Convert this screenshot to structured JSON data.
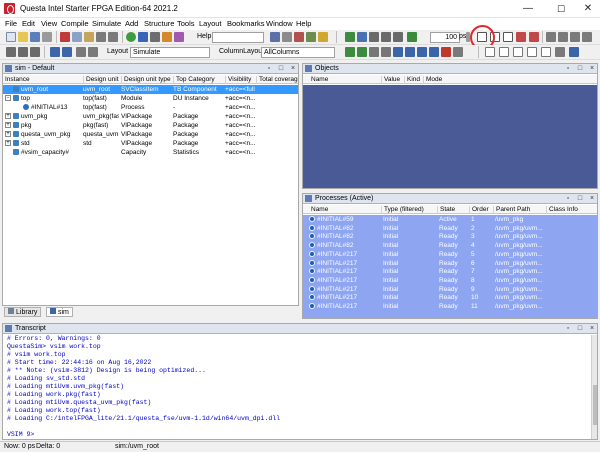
{
  "window": {
    "title": "Questa Intel Starter FPGA Edition-64 2021.2",
    "controls": {
      "minimize": "—",
      "maximize": "☐",
      "close": "✕"
    }
  },
  "menu": [
    "File",
    "Edit",
    "View",
    "Compile",
    "Simulate",
    "Add",
    "Structure",
    "Tools",
    "Layout",
    "Bookmarks",
    "Window",
    "Help"
  ],
  "toolbar": {
    "help_label": "Help",
    "help_value": "",
    "runtime_value": "100",
    "runtime_unit": "ps",
    "layout_label": "Layout",
    "layout_value": "Simulate",
    "column_layout_label": "ColumnLayout",
    "column_layout_value": "AllColumns"
  },
  "sim_pane": {
    "title": "sim - Default",
    "columns": [
      "Instance",
      "Design unit",
      "Design unit type",
      "Top Category",
      "Visibility",
      "Total coverage"
    ],
    "rows": [
      {
        "expander": "",
        "instance": "uvm_root",
        "design_unit": "uvm_root",
        "type": "SVClassItem",
        "category": "TB Component",
        "visibility": "+acc=<full>",
        "selected": true,
        "indent": 0
      },
      {
        "expander": "-",
        "instance": "top",
        "design_unit": "top(fast)",
        "type": "Module",
        "category": "DU Instance",
        "visibility": "+acc=<n...",
        "selected": false,
        "indent": 0
      },
      {
        "expander": "",
        "instance": "#INITIAL#13",
        "design_unit": "top(fast)",
        "type": "Process",
        "category": "-",
        "visibility": "+acc=<n...",
        "selected": false,
        "indent": 1
      },
      {
        "expander": "+",
        "instance": "uvm_pkg",
        "design_unit": "uvm_pkg(fast)",
        "type": "VlPackage",
        "category": "Package",
        "visibility": "+acc=<n...",
        "selected": false,
        "indent": 0
      },
      {
        "expander": "+",
        "instance": "pkg",
        "design_unit": "pkg(fast)",
        "type": "VlPackage",
        "category": "Package",
        "visibility": "+acc=<n...",
        "selected": false,
        "indent": 0
      },
      {
        "expander": "+",
        "instance": "questa_uvm_pkg",
        "design_unit": "questa_uvm...",
        "type": "VlPackage",
        "category": "Package",
        "visibility": "+acc=<n...",
        "selected": false,
        "indent": 0
      },
      {
        "expander": "+",
        "instance": "std",
        "design_unit": "std",
        "type": "VlPackage",
        "category": "Package",
        "visibility": "+acc=<n...",
        "selected": false,
        "indent": 0
      },
      {
        "expander": "",
        "instance": "#vsim_capacity#",
        "design_unit": "",
        "type": "Capacity",
        "category": "Statistics",
        "visibility": "+acc=<n...",
        "selected": false,
        "indent": 0
      }
    ],
    "tabs": [
      "Library",
      "sim"
    ]
  },
  "objects_pane": {
    "title": "Objects",
    "columns": [
      "Name",
      "Value",
      "Kind",
      "Mode"
    ]
  },
  "processes_pane": {
    "title": "Processes (Active)",
    "columns": [
      "Name",
      "Type (filtered)",
      "State",
      "Order",
      "Parent Path",
      "Class Info"
    ],
    "rows": [
      {
        "name": "#INITIAL#59",
        "type": "Initial",
        "state": "Active",
        "order": "1",
        "parent": "/uvm_pkg"
      },
      {
        "name": "#INITIAL#82",
        "type": "Initial",
        "state": "Ready",
        "order": "2",
        "parent": "/uvm_pkg/uvm..."
      },
      {
        "name": "#INITIAL#82",
        "type": "Initial",
        "state": "Ready",
        "order": "3",
        "parent": "/uvm_pkg/uvm..."
      },
      {
        "name": "#INITIAL#82",
        "type": "Initial",
        "state": "Ready",
        "order": "4",
        "parent": "/uvm_pkg/uvm..."
      },
      {
        "name": "#INITIAL#217",
        "type": "Initial",
        "state": "Ready",
        "order": "5",
        "parent": "/uvm_pkg/uvm..."
      },
      {
        "name": "#INITIAL#217",
        "type": "Initial",
        "state": "Ready",
        "order": "6",
        "parent": "/uvm_pkg/uvm..."
      },
      {
        "name": "#INITIAL#217",
        "type": "Initial",
        "state": "Ready",
        "order": "7",
        "parent": "/uvm_pkg/uvm..."
      },
      {
        "name": "#INITIAL#217",
        "type": "Initial",
        "state": "Ready",
        "order": "8",
        "parent": "/uvm_pkg/uvm..."
      },
      {
        "name": "#INITIAL#217",
        "type": "Initial",
        "state": "Ready",
        "order": "9",
        "parent": "/uvm_pkg/uvm..."
      },
      {
        "name": "#INITIAL#217",
        "type": "Initial",
        "state": "Ready",
        "order": "10",
        "parent": "/uvm_pkg/uvm..."
      },
      {
        "name": "#INITIAL#217",
        "type": "Initial",
        "state": "Ready",
        "order": "11",
        "parent": "/uvm_pkg/uvm..."
      }
    ]
  },
  "transcript": {
    "title": "Transcript",
    "lines": [
      "# Errors: 0, Warnings: 0",
      "QuestaSim> vsim work.top",
      "# vsim work.top",
      "# Start time: 22:44:16 on Aug 16,2022",
      "# ** Note: (vsim-3812) Design is being optimized...",
      "# Loading sv_std.std",
      "# Loading mtiUvm.uvm_pkg(fast)",
      "# Loading work.pkg(fast)",
      "# Loading mtiUvm.questa_uvm_pkg(fast)",
      "# Loading work.top(fast)",
      "# Loading C:/intelFPGA_lite/21.1/questa_fse/uvm-1.1d/win64/uvm_dpi.dll",
      "",
      "VSIM 9>"
    ]
  },
  "status": {
    "now": "Now: 0 ps",
    "delta": "Delta: 0",
    "path": "sim:/uvm_root"
  },
  "colors": {
    "selection": "#3399ff",
    "process_row": "#8ea5f2",
    "objects_bg": "#4a5a96",
    "highlight_circle": "#e0282e"
  }
}
